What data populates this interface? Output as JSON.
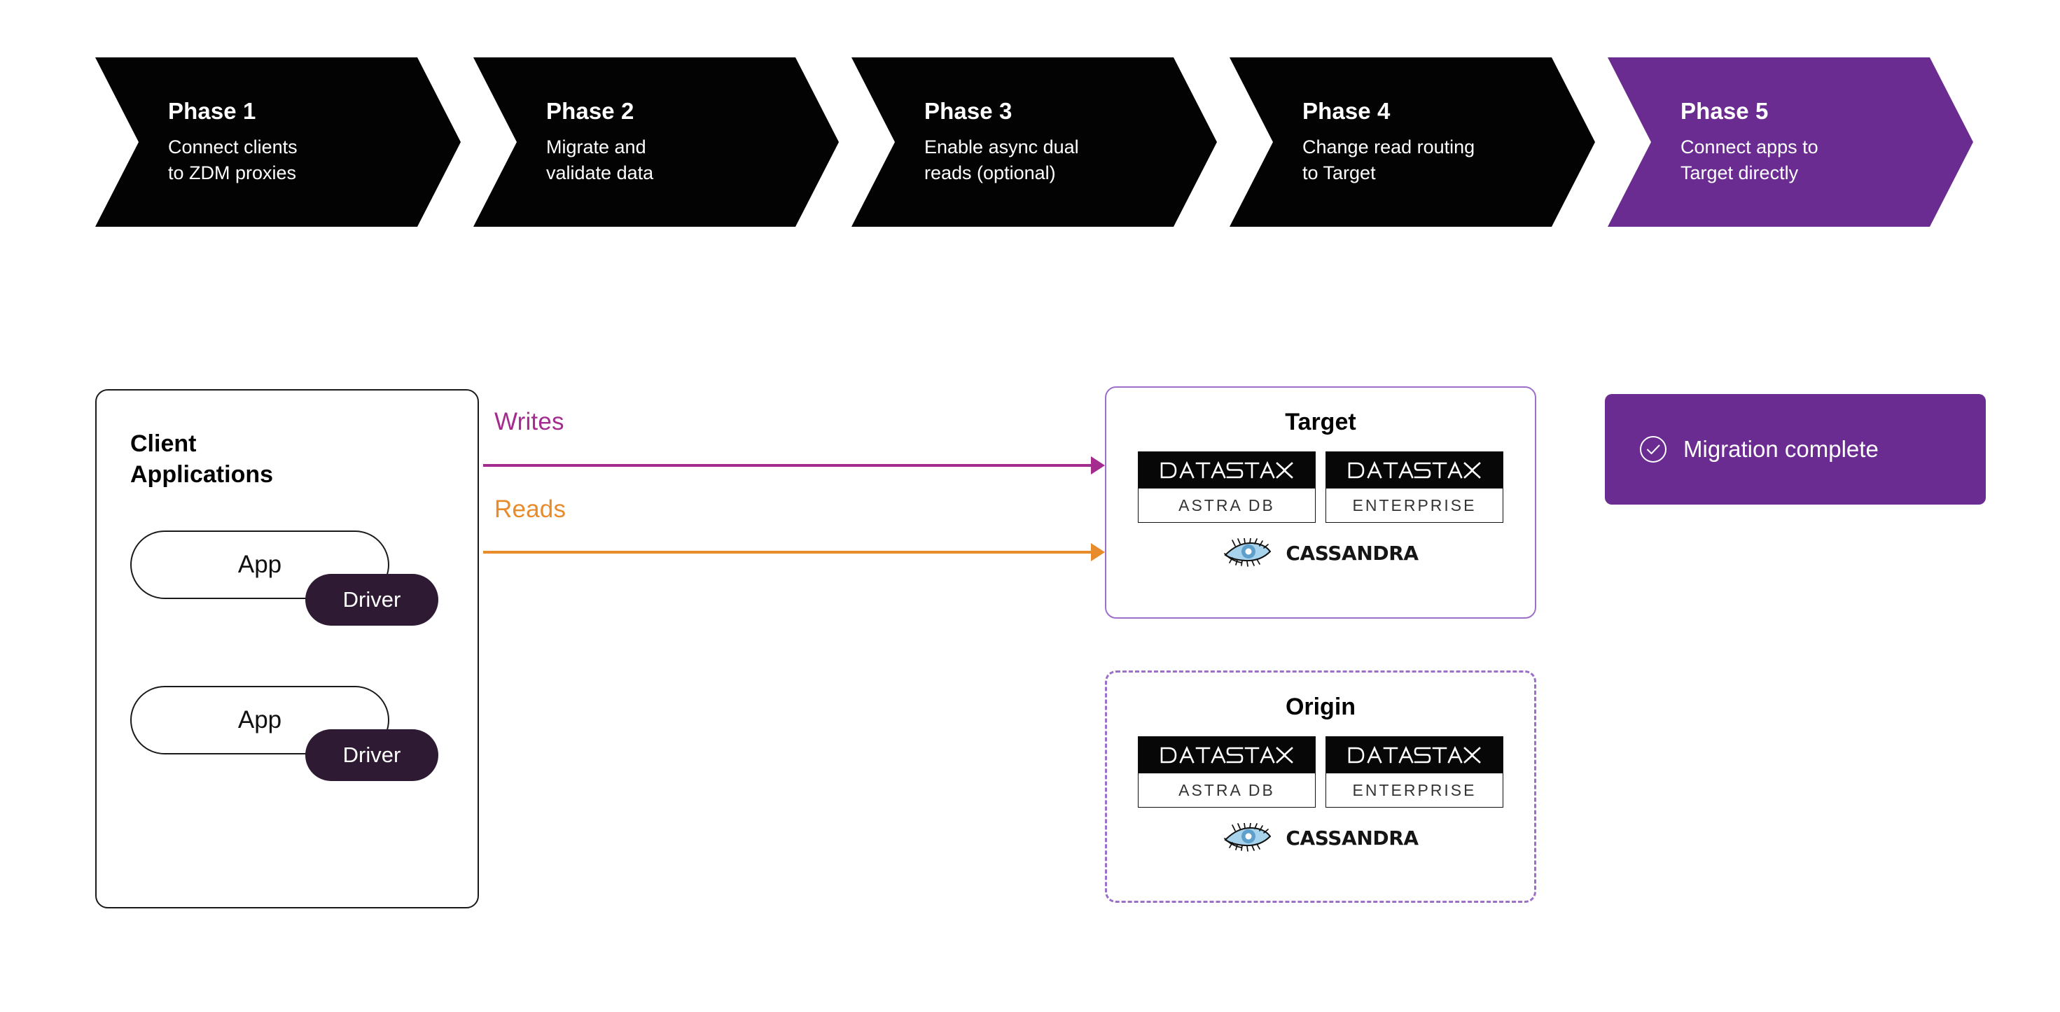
{
  "phases": [
    {
      "id": "phase-1",
      "title": "Phase 1",
      "desc": "Connect clients\nto ZDM proxies",
      "active": false,
      "color": "#030303"
    },
    {
      "id": "phase-2",
      "title": "Phase 2",
      "desc": "Migrate and\nvalidate data",
      "active": false,
      "color": "#030303"
    },
    {
      "id": "phase-3",
      "title": "Phase 3",
      "desc": "Enable async dual\nreads (optional)",
      "active": false,
      "color": "#030303"
    },
    {
      "id": "phase-4",
      "title": "Phase 4",
      "desc": "Change read routing\nto Target",
      "active": false,
      "color": "#030303"
    },
    {
      "id": "phase-5",
      "title": "Phase 5",
      "desc": "Connect apps to\nTarget directly",
      "active": true,
      "color": "#6B2C91"
    }
  ],
  "client_panel": {
    "title": "Client\nApplications",
    "apps": [
      {
        "app_label": "App",
        "driver_label": "Driver"
      },
      {
        "app_label": "App",
        "driver_label": "Driver"
      }
    ]
  },
  "flows": [
    {
      "id": "writes",
      "label": "Writes",
      "color": "#A42C8E"
    },
    {
      "id": "reads",
      "label": "Reads",
      "color": "#E78B2B"
    }
  ],
  "clusters": [
    {
      "id": "target",
      "title": "Target",
      "border_style": "solid",
      "border_color": "#9C6FC9",
      "products": [
        {
          "wordmark": "DATASTAX",
          "subtitle": "ASTRA DB"
        },
        {
          "wordmark": "DATASTAX",
          "subtitle": "ENTERPRISE"
        }
      ],
      "oss_label": "CASSANDRA"
    },
    {
      "id": "origin",
      "title": "Origin",
      "border_style": "dashed",
      "border_color": "#9C6FC9",
      "products": [
        {
          "wordmark": "DATASTAX",
          "subtitle": "ASTRA DB"
        },
        {
          "wordmark": "DATASTAX",
          "subtitle": "ENTERPRISE"
        }
      ],
      "oss_label": "CASSANDRA"
    }
  ],
  "status_badge": {
    "label": "Migration complete",
    "icon": "check-circle-icon",
    "background": "#6B2C91"
  },
  "colors": {
    "brand_purple": "#6B2C91",
    "light_purple": "#9C6FC9",
    "writes_magenta": "#A42C8E",
    "reads_orange": "#E78B2B",
    "driver_dark": "#2E1B33",
    "chevron_black": "#030303"
  }
}
